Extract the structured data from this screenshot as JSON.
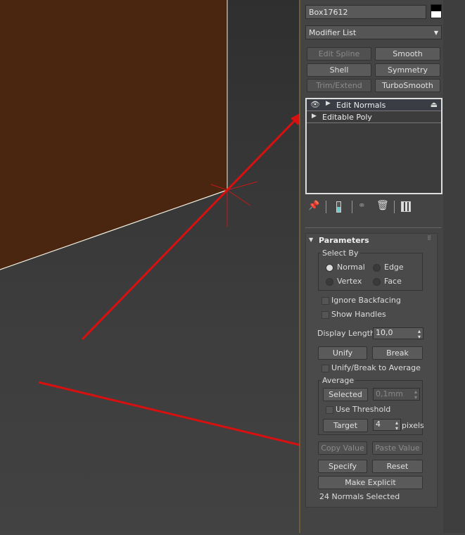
{
  "object_name": "Box17612",
  "modifier_list": "Modifier List",
  "modifier_buttons": [
    {
      "label": "Edit Spline",
      "enabled": false
    },
    {
      "label": "Smooth",
      "enabled": true
    },
    {
      "label": "Shell",
      "enabled": true
    },
    {
      "label": "Symmetry",
      "enabled": true
    },
    {
      "label": "Trim/Extend",
      "enabled": false
    },
    {
      "label": "TurboSmooth",
      "enabled": true
    }
  ],
  "stack": [
    "Edit Normals",
    "Editable Poly"
  ],
  "parameters": {
    "title": "Parameters",
    "select_by": "Select By",
    "normal": "Normal",
    "edge": "Edge",
    "vertex": "Vertex",
    "face": "Face",
    "ignore_backfacing": "Ignore Backfacing",
    "show_handles": "Show Handles",
    "display_length_label": "Display Length:",
    "display_length": "10,0",
    "unify": "Unify",
    "break": "Break",
    "unify_break_avg": "Unify/Break to Average",
    "average": "Average",
    "selected": "Selected",
    "selected_value": "0,1mm",
    "use_threshold": "Use Threshold",
    "target": "Target",
    "target_value": "4",
    "pixels": "pixels",
    "copy_value": "Copy Value",
    "paste_value": "Paste Value",
    "specify": "Specify",
    "reset": "Reset",
    "make_explicit": "Make Explicit",
    "status": "24 Normals Selected"
  },
  "colors": {
    "object_face": "#4a2510",
    "annotation": "#d81010"
  }
}
